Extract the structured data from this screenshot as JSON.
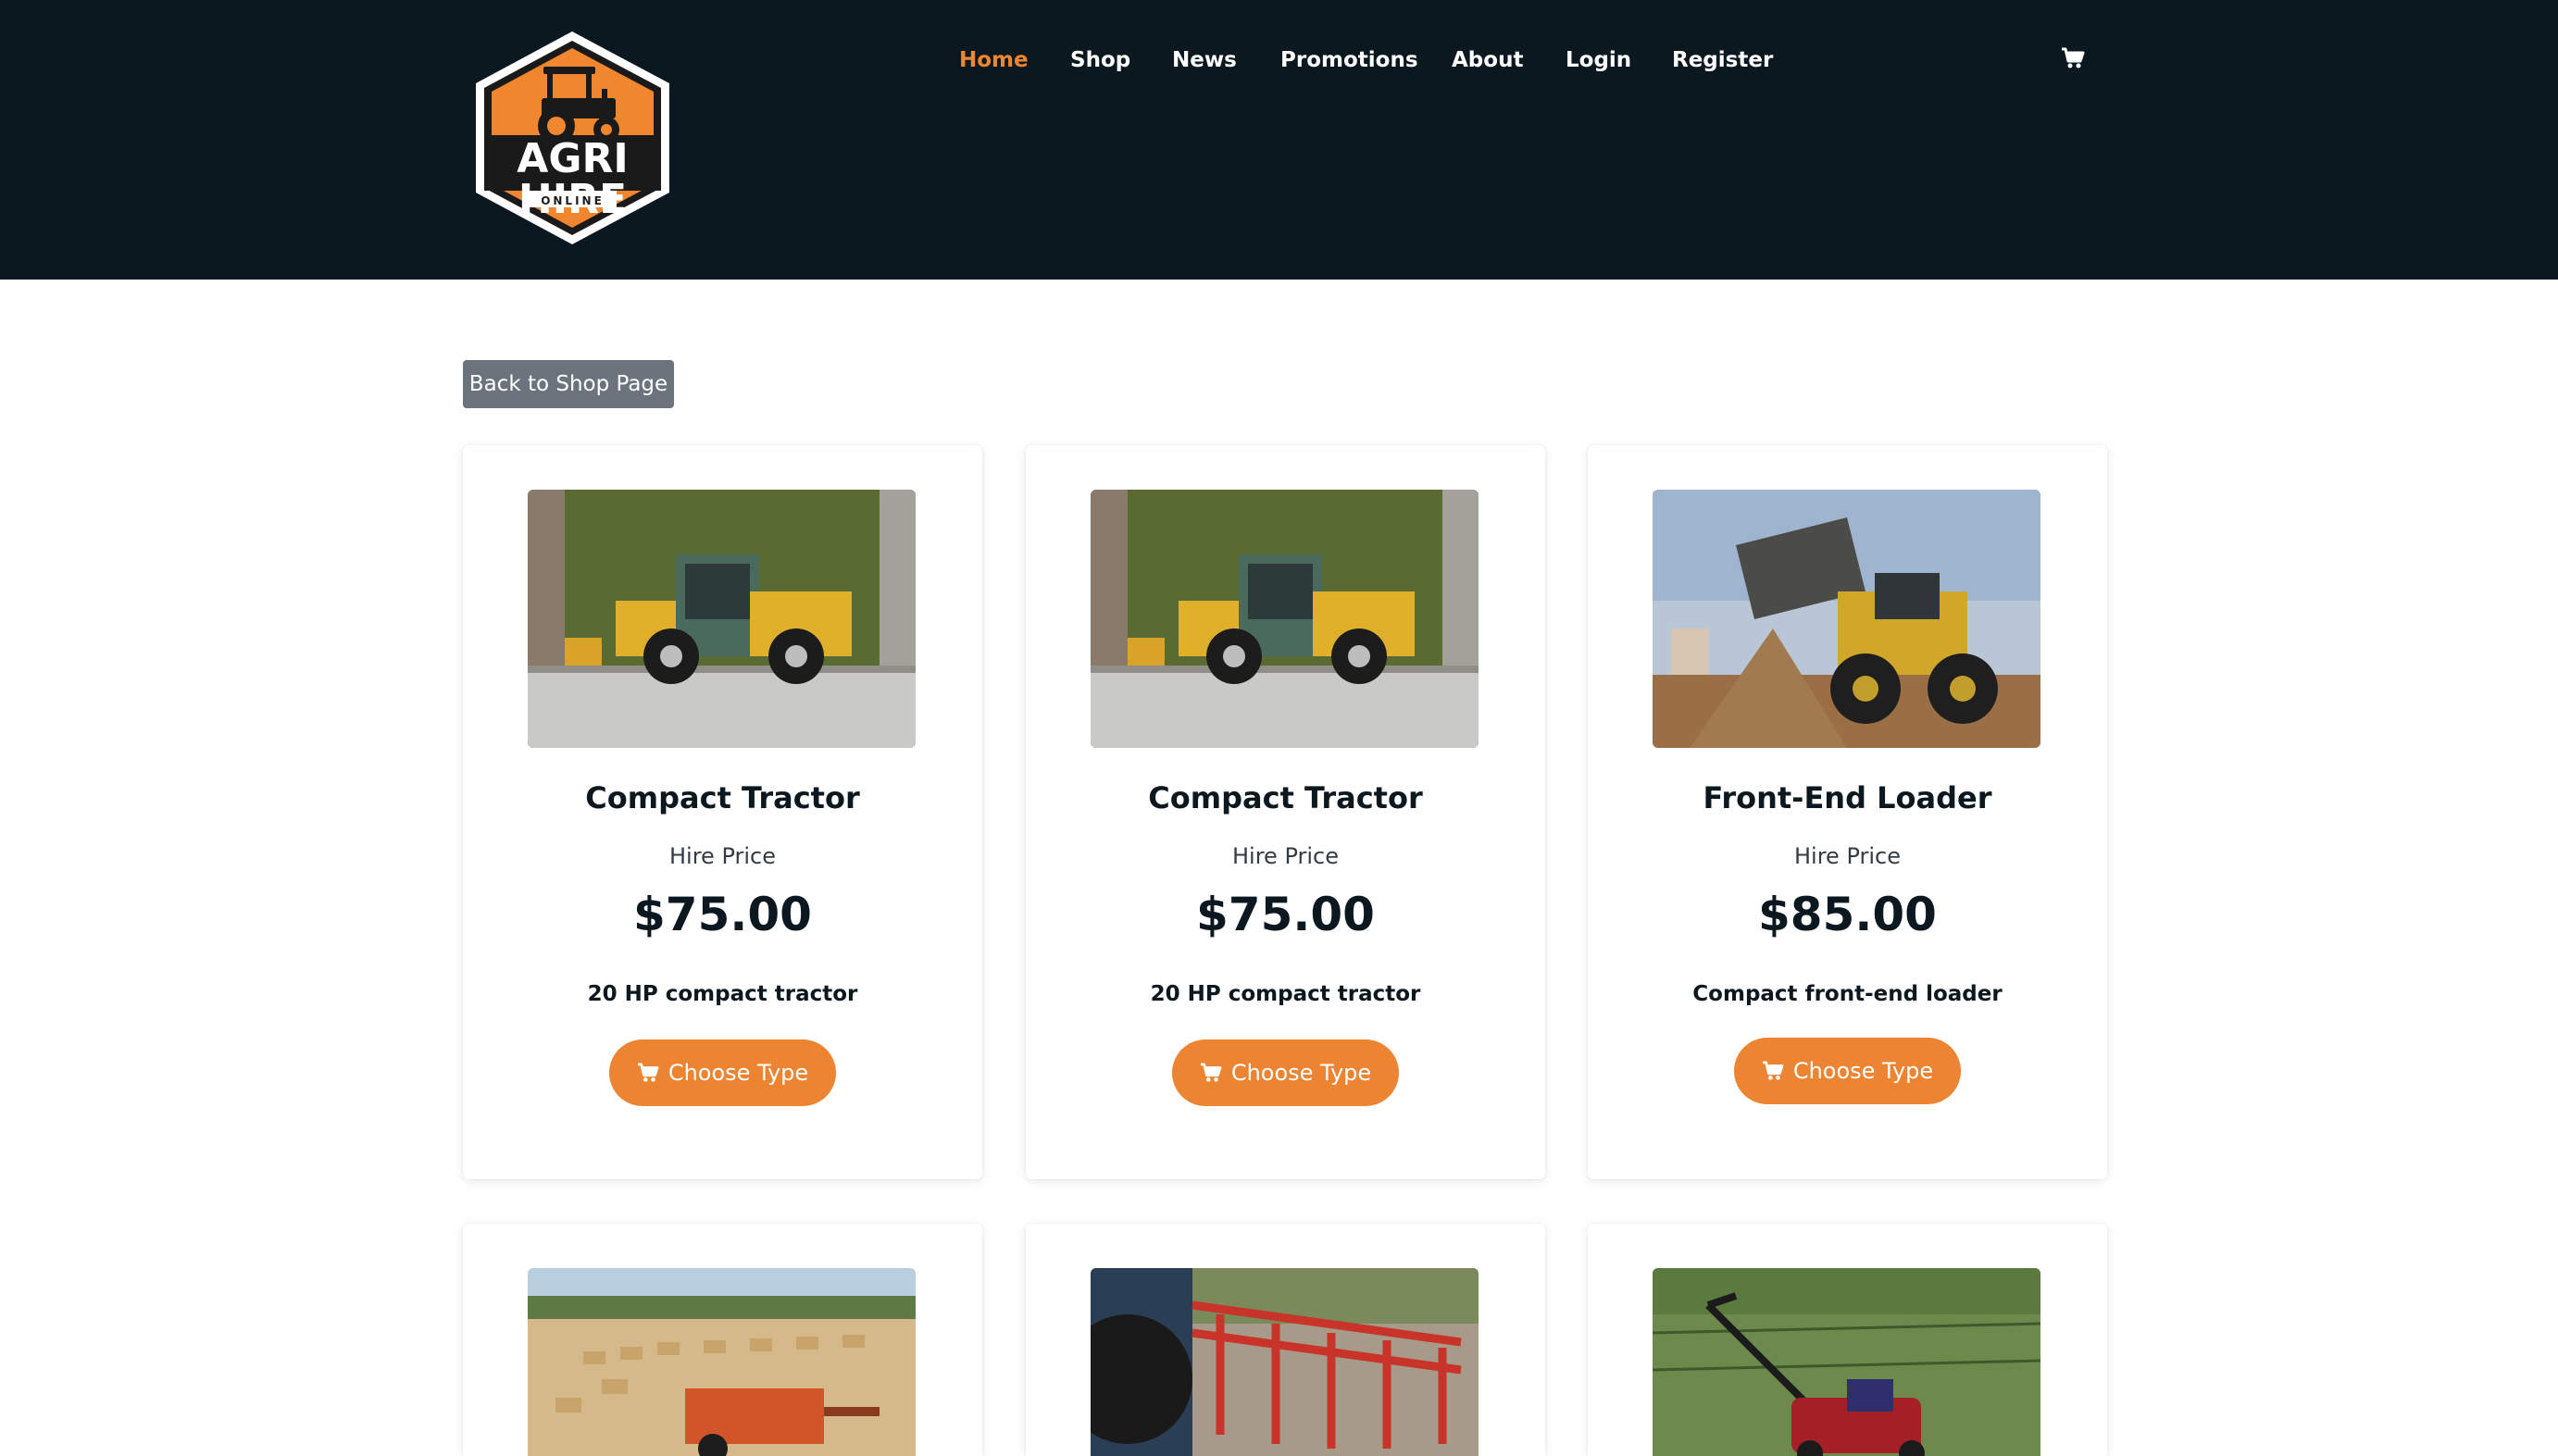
{
  "logo": {
    "text": "AGRI HIRE",
    "sub": "ONLINE"
  },
  "nav": {
    "items": [
      {
        "label": "Home",
        "active": true
      },
      {
        "label": "Shop",
        "active": false
      },
      {
        "label": "News",
        "active": false
      },
      {
        "label": "Promotions",
        "active": false
      },
      {
        "label": "About",
        "active": false
      },
      {
        "label": "Login",
        "active": false
      },
      {
        "label": "Register",
        "active": false
      }
    ]
  },
  "cart": {
    "icon": "cart-icon"
  },
  "back_button": {
    "label": "Back to Shop Page"
  },
  "products": [
    {
      "title": "Compact Tractor",
      "sub": "Hire Price",
      "price": "$75.00",
      "desc": "20 HP compact tractor",
      "button": "Choose Type",
      "image": "compact-tractor-image"
    },
    {
      "title": "Compact Tractor",
      "sub": "Hire Price",
      "price": "$75.00",
      "desc": "20 HP compact tractor",
      "button": "Choose Type",
      "image": "compact-tractor-image"
    },
    {
      "title": "Front-End Loader",
      "sub": "Hire Price",
      "price": "$85.00",
      "desc": "Compact front-end loader",
      "button": "Choose Type",
      "image": "front-end-loader-image"
    },
    {
      "image": "hay-baler-image"
    },
    {
      "image": "cultivator-image"
    },
    {
      "image": "lawn-mower-image"
    }
  ],
  "colors": {
    "header_bg": "#0c1820",
    "accent": "#ec8431",
    "active_nav": "#f0862d",
    "back_button": "#6b747c"
  }
}
